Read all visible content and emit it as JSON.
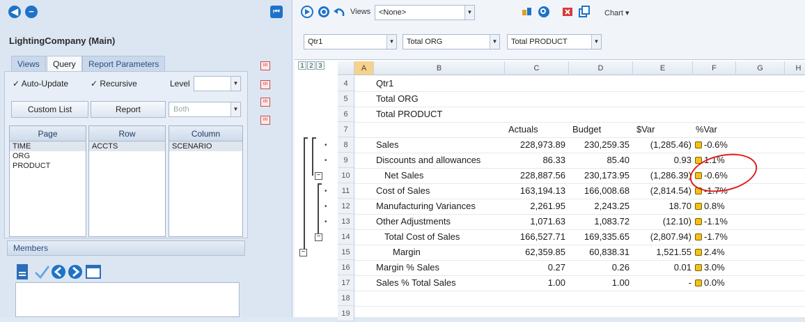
{
  "app": {
    "title": "LightingCompany (Main)"
  },
  "tabs": [
    {
      "label": "Views",
      "active": false
    },
    {
      "label": "Query",
      "active": true
    },
    {
      "label": "Report Parameters",
      "active": false
    }
  ],
  "query": {
    "auto_update": "✓ Auto-Update",
    "recursive": "✓ Recursive",
    "level_label": "Level",
    "level_value": "",
    "custom_list": "Custom List",
    "report": "Report",
    "both": "Both"
  },
  "lists": {
    "page": {
      "header": "Page",
      "items": [
        "TIME",
        "ORG",
        "PRODUCT"
      ]
    },
    "row": {
      "header": "Row",
      "items": [
        "ACCTS"
      ]
    },
    "column": {
      "header": "Column",
      "items": [
        "SCENARIO"
      ]
    }
  },
  "members": {
    "header": "Members"
  },
  "toolbar": {
    "views_label": "Views",
    "views_value": "<None>",
    "chart_label": "Chart ▾"
  },
  "pov": {
    "time": "Qtr1",
    "org": "Total ORG",
    "product": "Total PRODUCT"
  },
  "grid": {
    "levels": [
      "1",
      "2",
      "3"
    ],
    "columns": [
      "A",
      "B",
      "C",
      "D",
      "E",
      "F",
      "G",
      "H"
    ],
    "rows": [
      {
        "n": "4",
        "label": "Qtr1",
        "c": "",
        "d": "",
        "e": "",
        "f": "",
        "badge": false
      },
      {
        "n": "5",
        "label": "Total ORG",
        "c": "",
        "d": "",
        "e": "",
        "f": "",
        "badge": false
      },
      {
        "n": "6",
        "label": "Total PRODUCT",
        "c": "",
        "d": "",
        "e": "",
        "f": "",
        "badge": false
      },
      {
        "n": "7",
        "label": "",
        "c": "Actuals",
        "d": "Budget",
        "e": "$Var",
        "f": "%Var",
        "badge": false
      },
      {
        "n": "8",
        "label": "Sales",
        "c": "228,973.89",
        "d": "230,259.35",
        "e": "(1,285.46)",
        "f": "-0.6%",
        "badge": true
      },
      {
        "n": "9",
        "label": "Discounts and allowances",
        "c": "86.33",
        "d": "85.40",
        "e": "0.93",
        "f": "1.1%",
        "badge": true
      },
      {
        "n": "10",
        "label": "Net Sales",
        "indent": 1,
        "c": "228,887.56",
        "d": "230,173.95",
        "e": "(1,286.39)",
        "f": "-0.6%",
        "badge": true
      },
      {
        "n": "11",
        "label": "Cost of Sales",
        "c": "163,194.13",
        "d": "166,008.68",
        "e": "(2,814.54)",
        "f": "-1.7%",
        "badge": true
      },
      {
        "n": "12",
        "label": "Manufacturing Variances",
        "c": "2,261.95",
        "d": "2,243.25",
        "e": "18.70",
        "f": "0.8%",
        "badge": true
      },
      {
        "n": "13",
        "label": "Other Adjustments",
        "c": "1,071.63",
        "d": "1,083.72",
        "e": "(12.10)",
        "f": "-1.1%",
        "badge": true
      },
      {
        "n": "14",
        "label": "Total Cost of Sales",
        "indent": 1,
        "c": "166,527.71",
        "d": "169,335.65",
        "e": "(2,807.94)",
        "f": "-1.7%",
        "badge": true
      },
      {
        "n": "15",
        "label": "Margin",
        "indent": 2,
        "c": "62,359.85",
        "d": "60,838.31",
        "e": "1,521.55",
        "f": "2.4%",
        "badge": true
      },
      {
        "n": "16",
        "label": "Margin % Sales",
        "c": "0.27",
        "d": "0.26",
        "e": "0.01",
        "f": "3.0%",
        "badge": true
      },
      {
        "n": "17",
        "label": "Sales % Total Sales",
        "c": "1.00",
        "d": "1.00",
        "e": "-",
        "f": "0.0%",
        "badge": true
      },
      {
        "n": "18",
        "label": "",
        "c": "",
        "d": "",
        "e": "",
        "f": "",
        "badge": false
      },
      {
        "n": "19",
        "label": "",
        "c": "",
        "d": "",
        "e": "",
        "f": "",
        "badge": false
      }
    ]
  }
}
